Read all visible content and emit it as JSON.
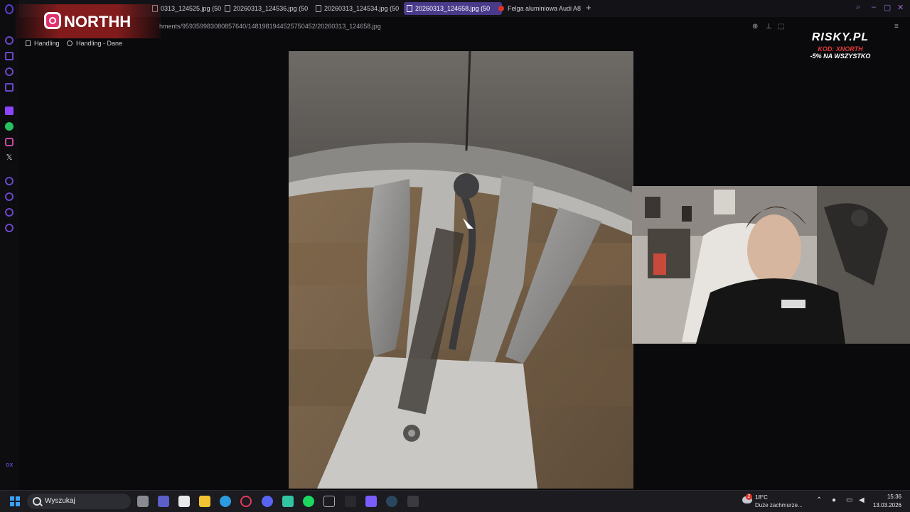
{
  "tabs": [
    {
      "label": "0313_124525.jpg (50",
      "active": false
    },
    {
      "label": "20260313_124536.jpg (50",
      "active": false
    },
    {
      "label": "20260313_124534.jpg (50",
      "active": false
    },
    {
      "label": "20260313_124658.jpg (50",
      "active": true
    },
    {
      "label": "Felga aluminiowa Audi A8",
      "active": false
    }
  ],
  "address": {
    "url": "hments/959359983080857640/1481981944525750452/20260313_124658.jpg"
  },
  "bookmarks": [
    {
      "label": "Handling",
      "icon": "bookmark-icon"
    },
    {
      "label": "Handling - Dane",
      "icon": "globe-icon"
    }
  ],
  "overlay": {
    "handle": "NORTHH"
  },
  "sponsor": {
    "logo": "RISKY.PL",
    "code": "KOD: XNORTH",
    "promo": "-5% NA WSZYSTKO"
  },
  "sidebar": {
    "brand": "GX"
  },
  "taskbar": {
    "search_placeholder": "Wyszukaj",
    "weather_temp": "18°C",
    "weather_desc": "Duże zachmurze...",
    "weather_badge": "2",
    "time": "15:36",
    "date": "13.03.2026"
  },
  "colors": {
    "accent": "#4a3a8a",
    "opera": "#5b3bd0",
    "brand_red": "#d9342b"
  }
}
